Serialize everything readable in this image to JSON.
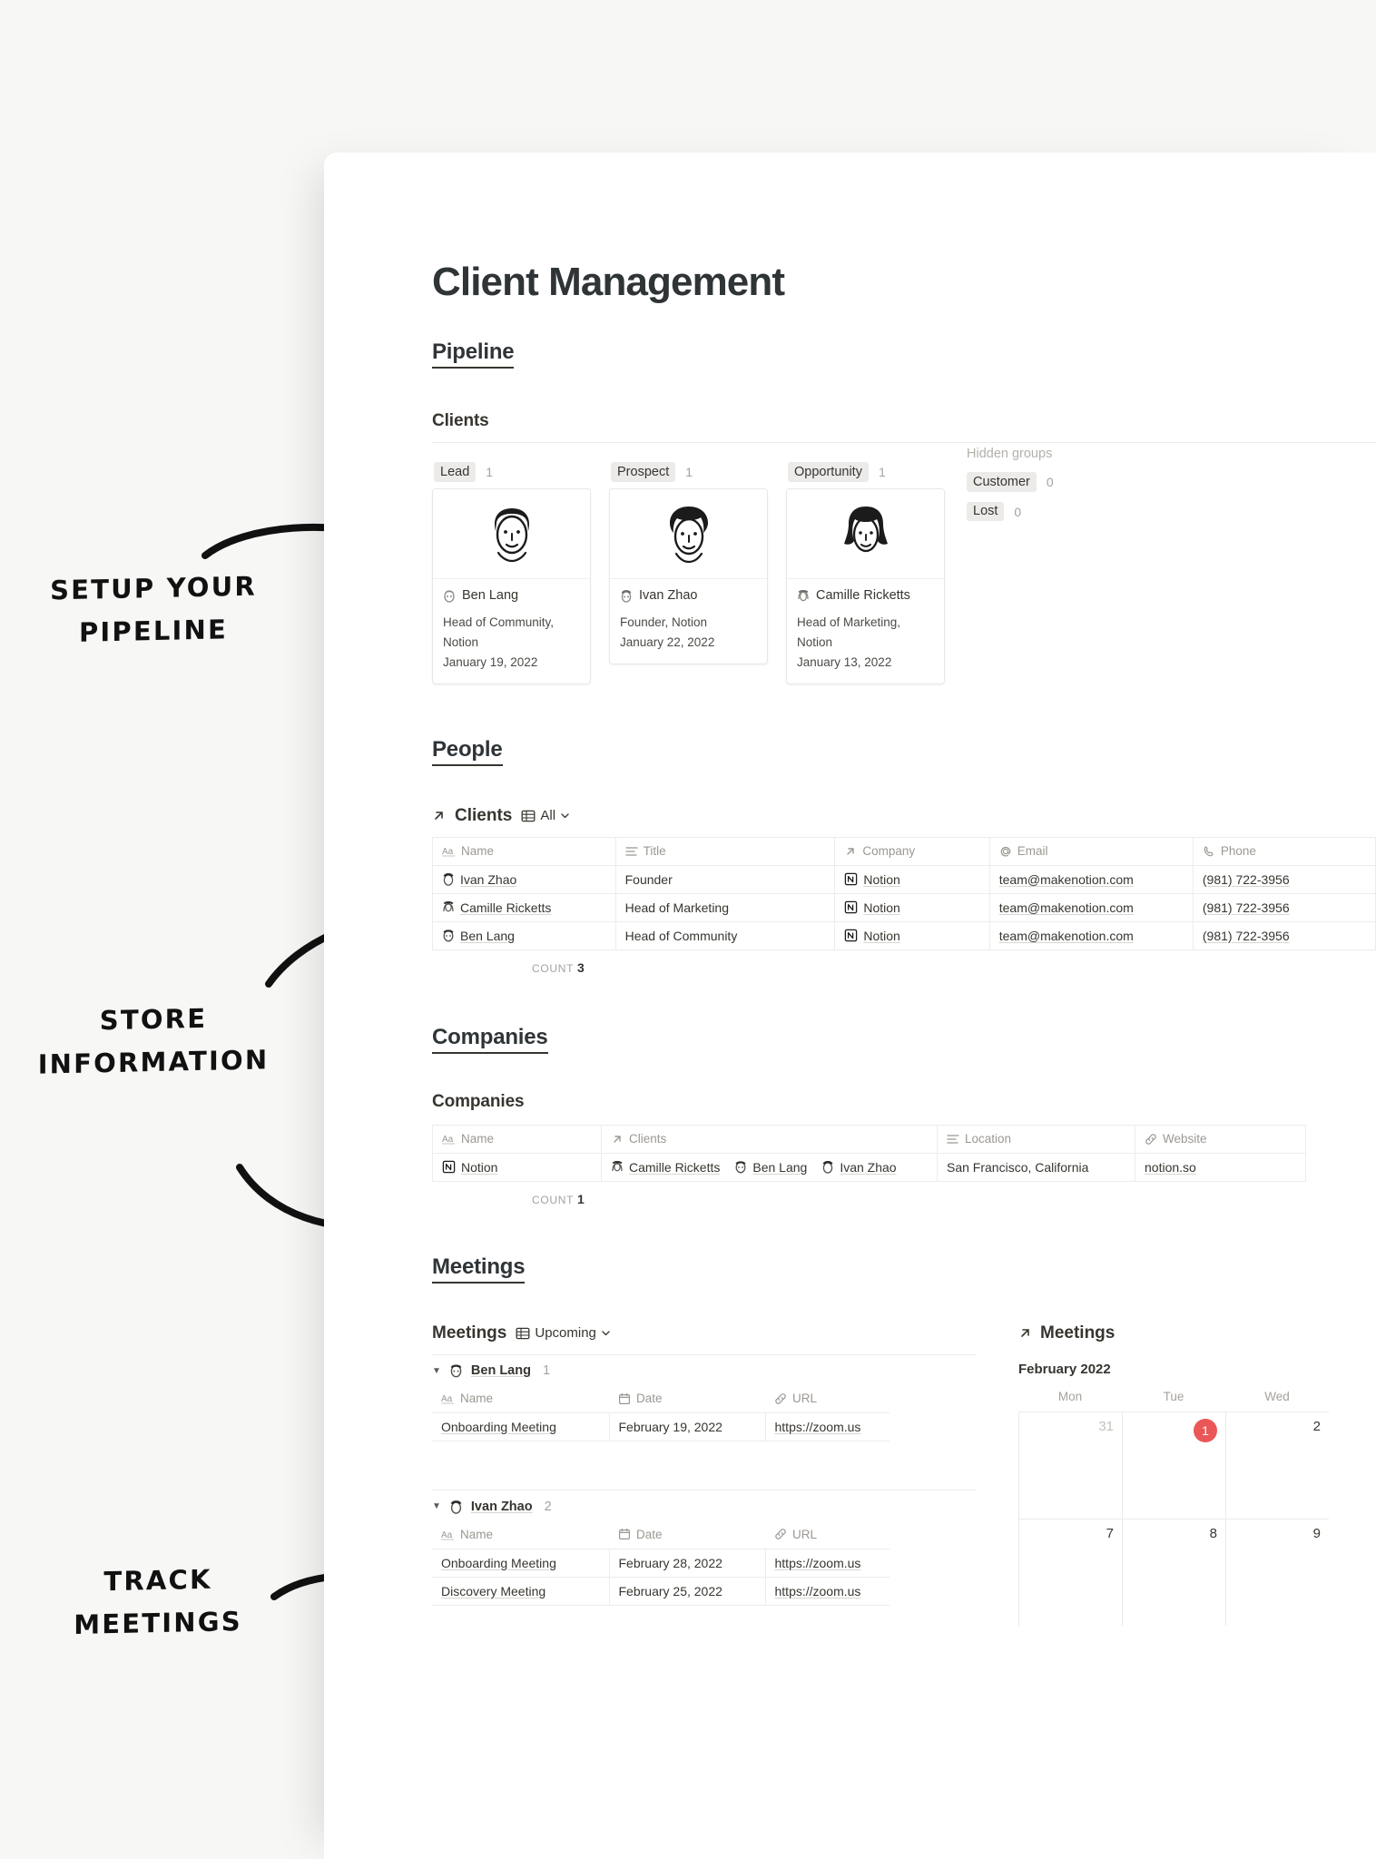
{
  "annotations": [
    {
      "text": "SETUP YOUR\nPIPELINE",
      "id": "setup-your-pipeline"
    },
    {
      "text": "STORE\nINFORMATION",
      "id": "store-information"
    },
    {
      "text": "TRACK\nMEETINGS",
      "id": "track-meetings"
    }
  ],
  "page": {
    "title": "Client Management"
  },
  "pipeline": {
    "heading": "Pipeline",
    "database_title": "Clients",
    "columns": [
      {
        "status": "Lead",
        "count": "1",
        "card": {
          "name": "Ben Lang",
          "meta": "Head of Community, Notion",
          "date": "January 19, 2022",
          "avatar": "man-short-hair-illustration"
        }
      },
      {
        "status": "Prospect",
        "count": "1",
        "card": {
          "name": "Ivan Zhao",
          "meta": "Founder, Notion",
          "date": "January 22, 2022",
          "avatar": "man-curly-hair-illustration"
        }
      },
      {
        "status": "Opportunity",
        "count": "1",
        "card": {
          "name": "Camille Ricketts",
          "meta": "Head of Marketing, Notion",
          "date": "January 13, 2022",
          "avatar": "woman-long-hair-illustration"
        }
      }
    ],
    "hidden_groups": {
      "label": "Hidden groups",
      "items": [
        {
          "status": "Customer",
          "count": "0"
        },
        {
          "status": "Lost",
          "count": "0"
        }
      ]
    }
  },
  "people": {
    "heading": "People",
    "database_title": "Clients",
    "view_label": "All",
    "columns": [
      {
        "label": "Name",
        "icon": "title-aa-icon"
      },
      {
        "label": "Title",
        "icon": "text-lines-icon"
      },
      {
        "label": "Company",
        "icon": "relation-arrow-icon"
      },
      {
        "label": "Email",
        "icon": "at-sign-icon"
      },
      {
        "label": "Phone",
        "icon": "phone-icon"
      }
    ],
    "rows": [
      {
        "name": "Ivan Zhao",
        "title": "Founder",
        "company": "Notion",
        "email": "team@makenotion.com",
        "phone": "(981) 722-3956"
      },
      {
        "name": "Camille Ricketts",
        "title": "Head of Marketing",
        "company": "Notion",
        "email": "team@makenotion.com",
        "phone": "(981) 722-3956"
      },
      {
        "name": "Ben Lang",
        "title": "Head of Community",
        "company": "Notion",
        "email": "team@makenotion.com",
        "phone": "(981) 722-3956"
      }
    ],
    "count_label": "COUNT",
    "count_value": "3"
  },
  "companies": {
    "heading": "Companies",
    "database_title": "Companies",
    "columns": [
      {
        "label": "Name",
        "icon": "title-aa-icon"
      },
      {
        "label": "Clients",
        "icon": "relation-arrow-icon"
      },
      {
        "label": "Location",
        "icon": "text-lines-icon"
      },
      {
        "label": "Website",
        "icon": "link-icon"
      }
    ],
    "rows": [
      {
        "name": "Notion",
        "clients": [
          "Camille Ricketts",
          "Ben Lang",
          "Ivan Zhao"
        ],
        "location": "San Francisco, California",
        "website": "notion.so"
      }
    ],
    "count_label": "COUNT",
    "count_value": "1"
  },
  "meetings": {
    "heading": "Meetings",
    "database_title": "Meetings",
    "view_label": "Upcoming",
    "columns": [
      {
        "label": "Name",
        "icon": "title-aa-icon"
      },
      {
        "label": "Date",
        "icon": "calendar-icon"
      },
      {
        "label": "URL",
        "icon": "link-icon"
      }
    ],
    "groups": [
      {
        "person": "Ben Lang",
        "count": "1",
        "rows": [
          {
            "name": "Onboarding Meeting",
            "date": "February 19, 2022",
            "url": "https://zoom.us"
          }
        ]
      },
      {
        "person": "Ivan Zhao",
        "count": "2",
        "rows": [
          {
            "name": "Onboarding Meeting",
            "date": "February 28, 2022",
            "url": "https://zoom.us"
          },
          {
            "name": "Discovery Meeting",
            "date": "February 25, 2022",
            "url": "https://zoom.us"
          }
        ]
      }
    ],
    "calendar": {
      "title": "Meetings",
      "month": "February 2022",
      "weekdays": [
        "Mon",
        "Tue",
        "Wed"
      ],
      "weeks": [
        [
          {
            "day": "31",
            "muted": true,
            "highlight": false
          },
          {
            "day": "1",
            "muted": false,
            "highlight": true
          },
          {
            "day": "2",
            "muted": false,
            "highlight": false
          }
        ],
        [
          {
            "day": "7",
            "muted": false,
            "highlight": false
          },
          {
            "day": "8",
            "muted": false,
            "highlight": false
          },
          {
            "day": "9",
            "muted": false,
            "highlight": false
          }
        ]
      ],
      "highlight_color": "#eb5757"
    }
  }
}
